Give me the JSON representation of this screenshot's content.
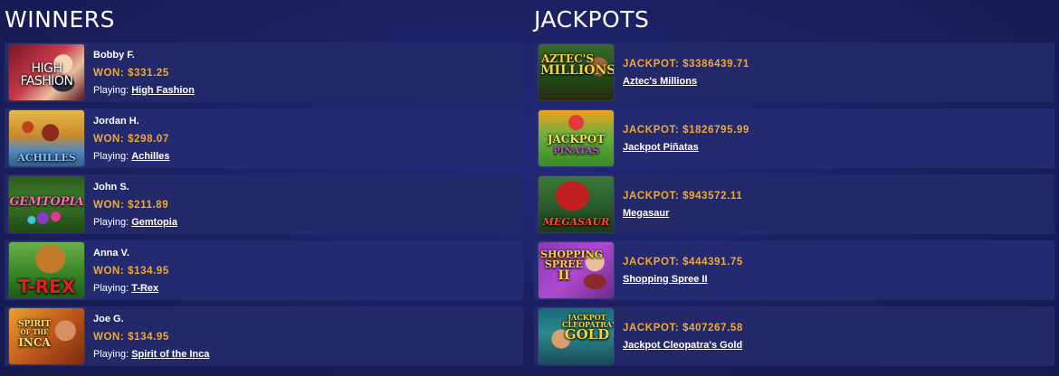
{
  "winners": {
    "title": "WINNERS",
    "playing_label": "Playing:",
    "items": [
      {
        "name": "Bobby F.",
        "won": "WON: $331.25",
        "game": "High Fashion",
        "thumb_text": "HIGH FASHION",
        "thumb_icon": "high-fashion-thumb"
      },
      {
        "name": "Jordan H.",
        "won": "WON: $298.07",
        "game": "Achilles",
        "thumb_text": "ACHILLES",
        "thumb_icon": "achilles-thumb"
      },
      {
        "name": "John S.",
        "won": "WON: $211.89",
        "game": "Gemtopia",
        "thumb_text": "GEMTOPIA",
        "thumb_icon": "gemtopia-thumb"
      },
      {
        "name": "Anna V.",
        "won": "WON: $134.95",
        "game": "T-Rex",
        "thumb_text": "T-REX",
        "thumb_icon": "t-rex-thumb"
      },
      {
        "name": "Joe G.",
        "won": "WON: $134.95",
        "game": "Spirit of the Inca",
        "thumb_text": "SPIRIT OF THE INCA",
        "thumb_icon": "spirit-of-the-inca-thumb"
      }
    ]
  },
  "jackpots": {
    "title": "JACKPOTS",
    "items": [
      {
        "amount": "JACKPOT: $3386439.71",
        "game": "Aztec's Millions",
        "thumb_text": "AZTEC'S MILLIONS",
        "thumb_icon": "aztecs-millions-thumb"
      },
      {
        "amount": "JACKPOT: $1826795.99",
        "game": "Jackpot Piñatas",
        "thumb_text": "JACKPOT PIÑATAS",
        "thumb_icon": "jackpot-pinatas-thumb"
      },
      {
        "amount": "JACKPOT: $943572.11",
        "game": "Megasaur",
        "thumb_text": "MEGASAUR",
        "thumb_icon": "megasaur-thumb"
      },
      {
        "amount": "JACKPOT: $444391.75",
        "game": "Shopping Spree II",
        "thumb_text": "SHOPPING SPREE II",
        "thumb_icon": "shopping-spree-ii-thumb"
      },
      {
        "amount": "JACKPOT: $407267.58",
        "game": "Jackpot Cleopatra's Gold",
        "thumb_text": "JACKPOT CLEOPATRA'S GOLD",
        "thumb_icon": "jackpot-cleopatras-gold-thumb"
      }
    ]
  },
  "colors": {
    "background": "#1b1f5c",
    "row": "#222868",
    "accent_amount": "#f0a733",
    "text": "#ffffff"
  }
}
